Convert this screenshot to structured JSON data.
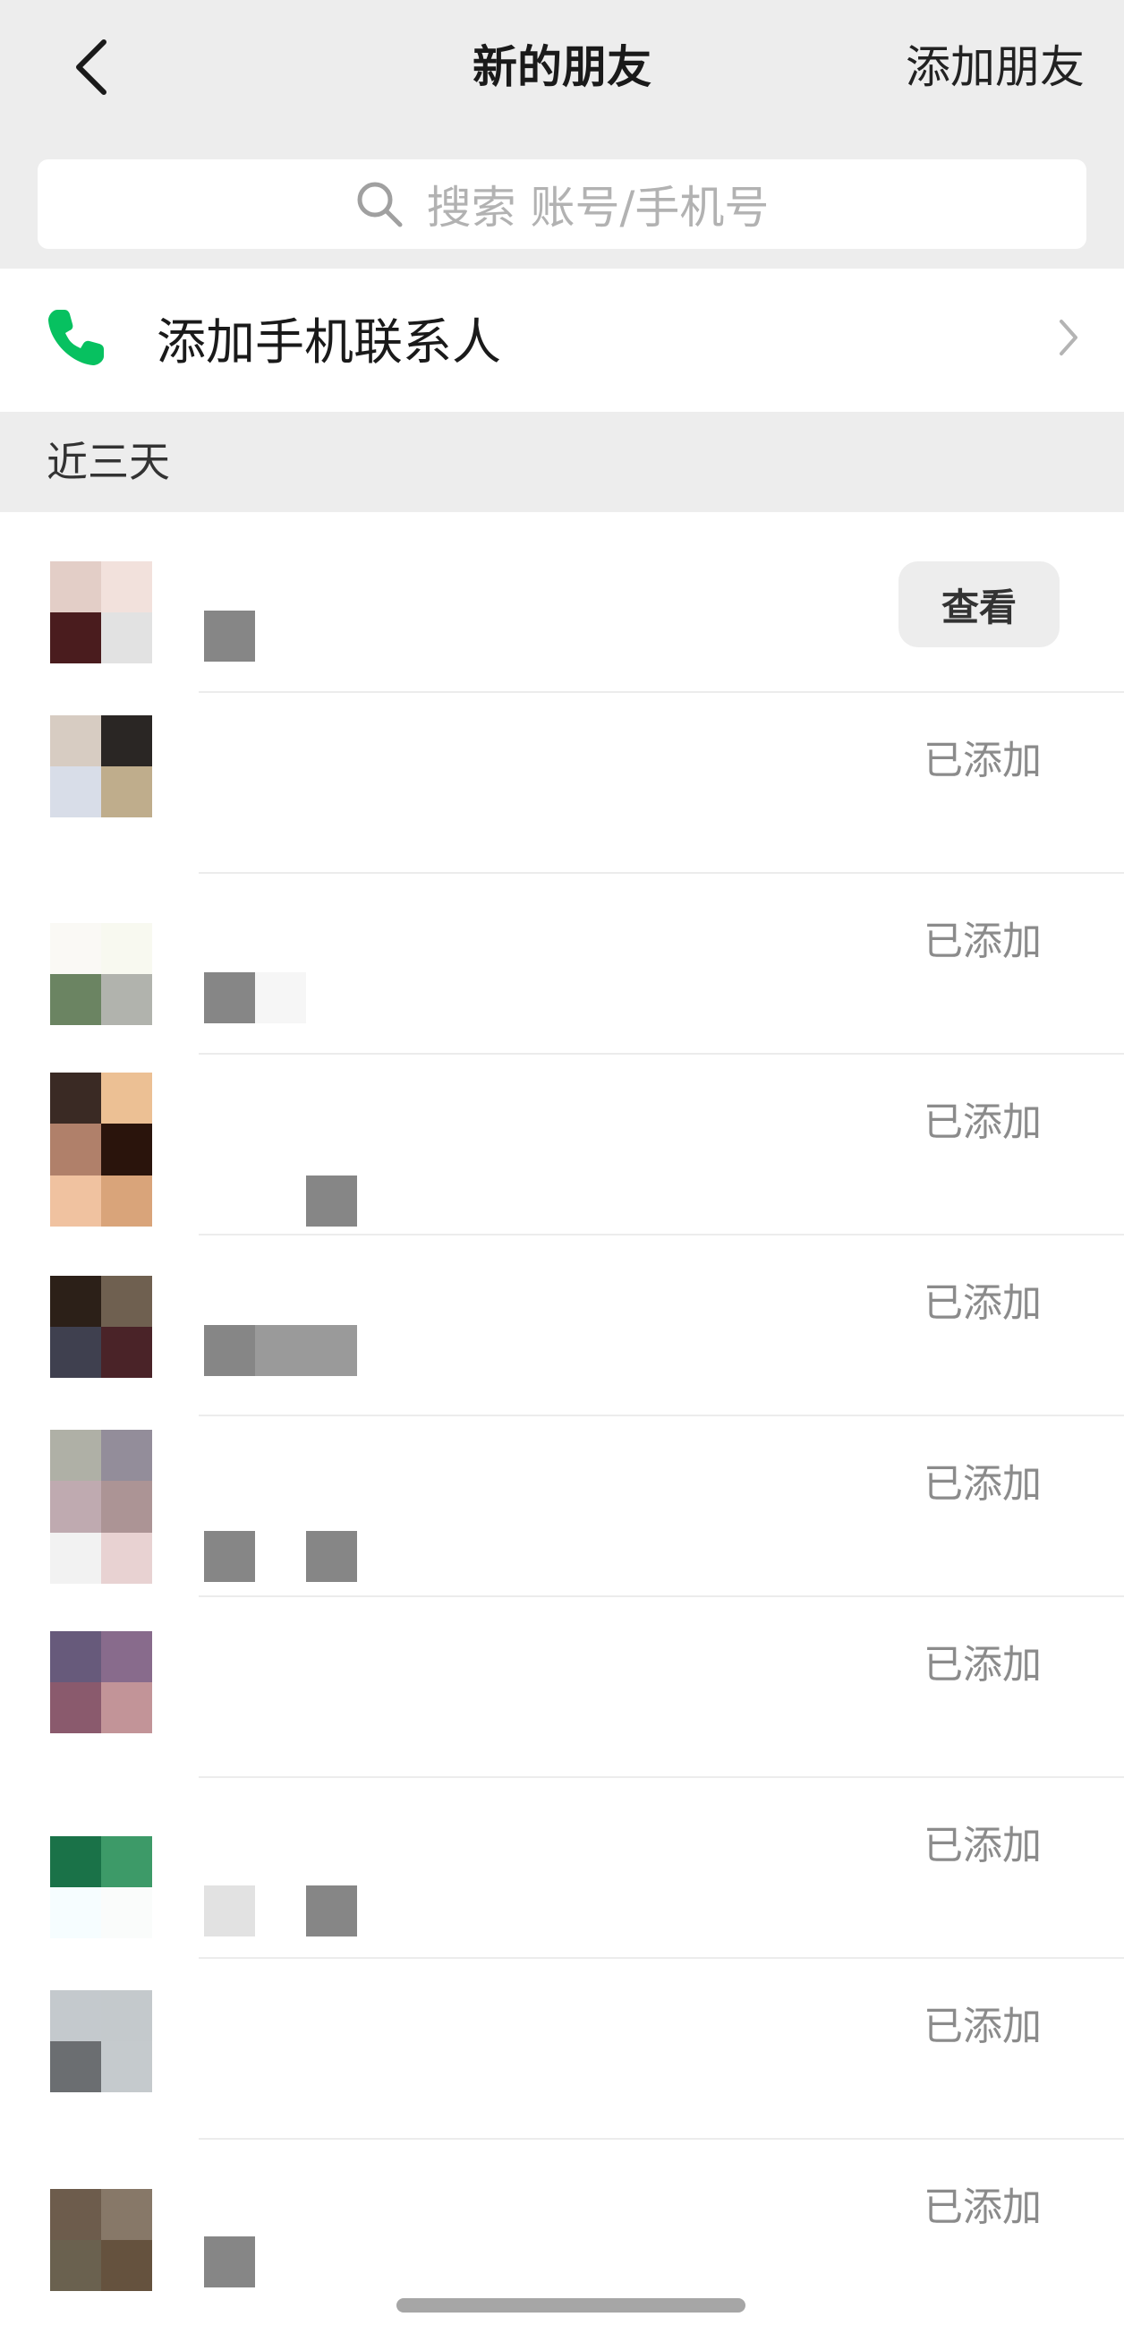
{
  "navbar": {
    "title": "新的朋友",
    "action": "添加朋友",
    "back_icon": "chevron-left-icon"
  },
  "search": {
    "placeholder": "搜索 账号/手机号",
    "icon": "search-icon"
  },
  "phone_contacts": {
    "label": "添加手机联系人",
    "icon": "phone-icon",
    "accent_color": "#07c160"
  },
  "section": {
    "title": "近三天"
  },
  "requests": [
    {
      "status": "查看",
      "type": "button"
    },
    {
      "status": "已添加",
      "type": "text"
    },
    {
      "status": "已添加",
      "type": "text"
    },
    {
      "status": "已添加",
      "type": "text"
    },
    {
      "status": "已添加",
      "type": "text"
    },
    {
      "status": "已添加",
      "type": "text"
    },
    {
      "status": "已添加",
      "type": "text"
    },
    {
      "status": "已添加",
      "type": "text"
    },
    {
      "status": "已添加",
      "type": "text"
    },
    {
      "status": "已添加",
      "type": "text"
    }
  ],
  "colors": {
    "background_gray": "#ededed",
    "muted_text": "#8b8b8b",
    "placeholder": "#b2b2b2"
  }
}
